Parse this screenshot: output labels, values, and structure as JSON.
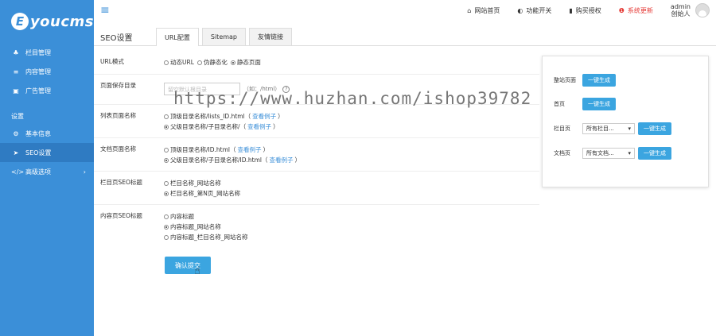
{
  "brand": {
    "logo_letter": "E",
    "logo_text": "youcms"
  },
  "sidebar": {
    "items": [
      {
        "icon": "sitemap-icon",
        "glyph": "♣",
        "label": "栏目管理"
      },
      {
        "icon": "list-icon",
        "glyph": "≡",
        "label": "内容管理"
      },
      {
        "icon": "image-icon",
        "glyph": "▣",
        "label": "广告管理"
      }
    ],
    "section_label": "设置",
    "settings": [
      {
        "icon": "gear-icon",
        "glyph": "⚙",
        "label": "基本信息"
      },
      {
        "icon": "send-icon",
        "glyph": "➤",
        "label": "SEO设置"
      },
      {
        "icon": "code-icon",
        "glyph": "</>",
        "label": "高级选项",
        "chevron": "›"
      }
    ]
  },
  "topbar": {
    "menu_glyph": "≡",
    "links": [
      {
        "glyph": "⌂",
        "label": "网站首页"
      },
      {
        "glyph": "◐",
        "label": "功能开关"
      },
      {
        "glyph": "▮",
        "label": "购买授权"
      },
      {
        "glyph": "❶",
        "label": "系统更新"
      }
    ],
    "user_name": "admin",
    "user_role": "创始人"
  },
  "page": {
    "title": "SEO设置",
    "tabs": [
      "URL配置",
      "Sitemap",
      "友情链接"
    ]
  },
  "form": {
    "url_mode": {
      "label": "URL模式",
      "options": [
        "动态URL",
        "伪静态化",
        "静态页面"
      ]
    },
    "save_dir": {
      "label": "页面保存目录",
      "placeholder": "留空默认根目录",
      "hint": "（如：/html）",
      "help": "?"
    },
    "list_name": {
      "label": "列表页面名称",
      "options": [
        {
          "text": "顶级目录名称/lists_ID.html",
          "link": "查看例子"
        },
        {
          "text": "父级目录名称/子目录名称/",
          "link": "查看例子"
        }
      ]
    },
    "doc_name": {
      "label": "文档页面名称",
      "options": [
        {
          "text": "顶级目录名称/ID.html",
          "link": "查看例子"
        },
        {
          "text": "父级目录名称/子目录名称/ID.html",
          "link": "查看例子"
        }
      ]
    },
    "list_seo": {
      "label": "栏目页SEO标题",
      "options": [
        "栏目名称_网站名称",
        "栏目名称_第N页_网站名称"
      ]
    },
    "content_seo": {
      "label": "内容页SEO标题",
      "options": [
        "内容标题",
        "内容标题_网站名称",
        "内容标题_栏目名称_网站名称"
      ]
    },
    "submit_label": "确认提交"
  },
  "panel": {
    "whole_site": {
      "label": "整站页面",
      "button": "一键生成"
    },
    "home": {
      "label": "首页",
      "button": "一键生成"
    },
    "column": {
      "label": "栏目页",
      "select": "所有栏目...",
      "button": "一键生成"
    },
    "doc": {
      "label": "文档页",
      "select": "所有文档...",
      "button": "一键生成"
    }
  },
  "watermark": "https://www.huzhan.com/ishop39782"
}
